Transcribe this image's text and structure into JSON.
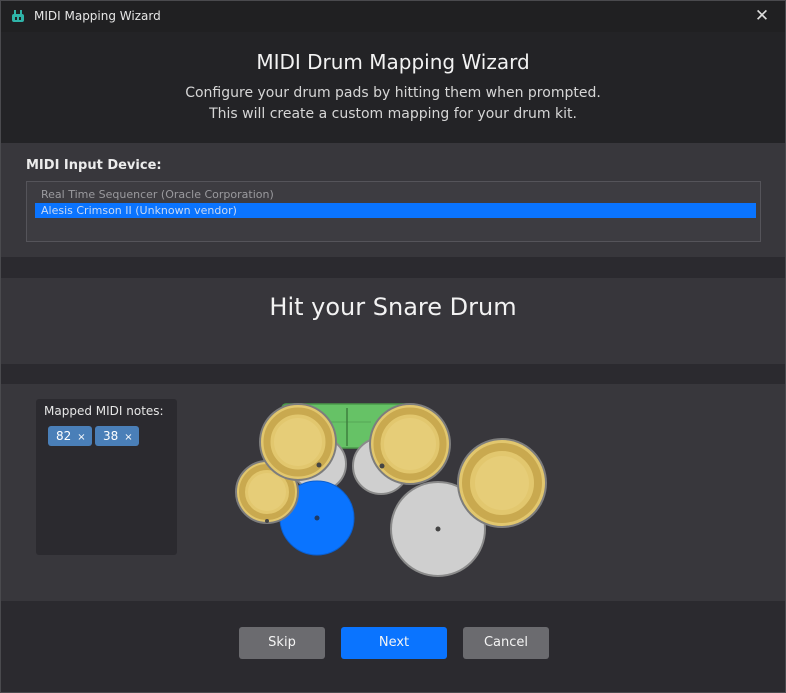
{
  "window": {
    "title": "MIDI Mapping Wizard",
    "app_icon": "drum-app-icon",
    "close_glyph": "✕"
  },
  "header": {
    "title": "MIDI Drum Mapping Wizard",
    "subtitle_line1": "Configure your drum pads by hitting them when prompted.",
    "subtitle_line2": "This will create a custom mapping for your drum kit."
  },
  "device": {
    "label": "MIDI Input Device:",
    "items": [
      {
        "label": "Real Time Sequencer (Oracle Corporation)",
        "selected": false
      },
      {
        "label": "Alesis Crimson II (Unknown vendor)",
        "selected": true
      }
    ]
  },
  "prompt": {
    "text": "Hit your Snare Drum"
  },
  "mapped": {
    "label": "Mapped MIDI notes:",
    "notes": [
      {
        "value": "82",
        "remove": "×"
      },
      {
        "value": "38",
        "remove": "×"
      }
    ]
  },
  "kit": {
    "highlighted_piece": "snare",
    "highlight_color": "#0a74ff",
    "cymbal_color": "#e2c76e",
    "drum_color": "#cfcfcf",
    "kick_color": "#66c266"
  },
  "buttons": {
    "skip": "Skip",
    "next": "Next",
    "cancel": "Cancel"
  },
  "colors": {
    "accent": "#0a74ff",
    "background": "#2b2a2f"
  }
}
